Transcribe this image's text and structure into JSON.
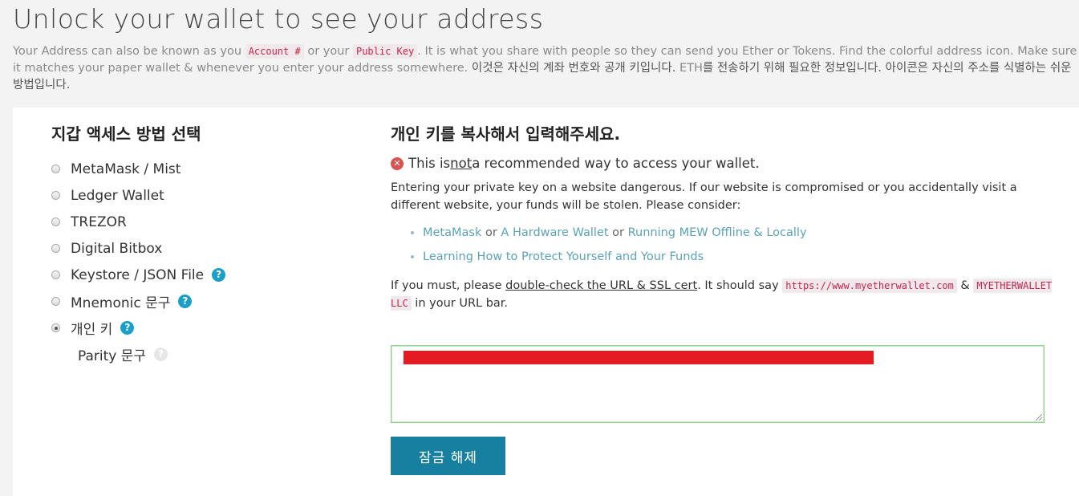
{
  "header": {
    "title": "Unlock your wallet to see your address",
    "intro_part1": "Your Address can also be known as you ",
    "code_account": "Account #",
    "intro_part2": " or your ",
    "code_public_key": "Public Key",
    "intro_part3": ". It is what you share with people so they can send you Ether or Tokens. Find the colorful address icon. Make sure it matches your paper wallet & whenever you enter your address somewhere. ",
    "intro_korean": "이것은 자신의 계좌 번호와 공개 키입니다. ",
    "intro_eth": "ETH",
    "intro_korean2": "를 전송하기 위해 필요한 정보입니다. 아이콘은 자신의 주소를 식별하는 쉬운 방법입니다."
  },
  "access_methods": {
    "title": "지갑 액세스 방법 선택",
    "options": [
      {
        "label": "MetaMask / Mist",
        "checked": false,
        "help": false
      },
      {
        "label": "Ledger Wallet",
        "checked": false,
        "help": false
      },
      {
        "label": "TREZOR",
        "checked": false,
        "help": false
      },
      {
        "label": "Digital Bitbox",
        "checked": false,
        "help": false
      },
      {
        "label": "Keystore / JSON File",
        "checked": false,
        "help": true
      },
      {
        "label": "Mnemonic 문구",
        "checked": false,
        "help": true
      },
      {
        "label": "개인 키",
        "checked": true,
        "help": true
      }
    ],
    "sub_option": {
      "label": "Parity 문구"
    },
    "help_glyph": "?"
  },
  "private_key_panel": {
    "title": "개인 키를 복사해서 입력해주세요.",
    "warning_icon": "x-circle-icon",
    "warning_prefix": "This is ",
    "warning_not": "not",
    "warning_suffix": " a recommended way to access your wallet.",
    "danger_text": "Entering your private key on a website dangerous. If our website is compromised or you accidentally visit a different website, your funds will be stolen. Please consider:",
    "link_metamask": "MetaMask",
    "or1": " or ",
    "link_hardware": "A Hardware Wallet",
    "or2": " or ",
    "link_offline": "Running MEW Offline & Locally",
    "link_learn": "Learning How to Protect Yourself and Your Funds",
    "must_prefix": "If you must, please ",
    "must_link": "double-check the URL & SSL cert",
    "must_mid": ". It should say ",
    "code_url": "https://www.myetherwallet.com",
    "amp": " & ",
    "code_llc": "MYETHERWALLET LLC",
    "must_suffix": " in your URL bar."
  },
  "unlock_button": "잠금 해제",
  "colors": {
    "accent": "#177fa0",
    "link": "#5aa2b8",
    "danger": "#d9534f",
    "redaction": "#e51b24",
    "input_border": "#8fd18f"
  }
}
